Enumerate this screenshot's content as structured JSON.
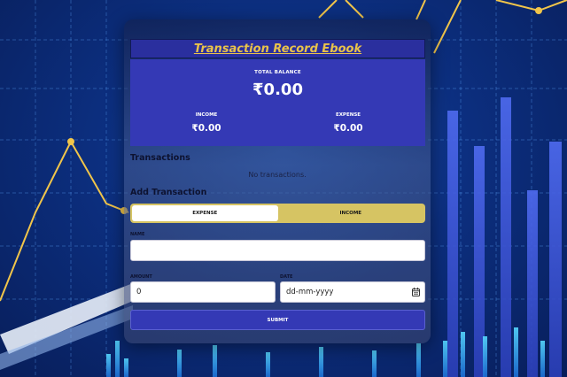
{
  "app": {
    "title": "Transaction Record Ebook"
  },
  "balance": {
    "total_label": "TOTAL BALANCE",
    "total_value": "₹0.00",
    "income_label": "INCOME",
    "income_value": "₹0.00",
    "expense_label": "EXPENSE",
    "expense_value": "₹0.00"
  },
  "transactions": {
    "heading": "Transactions",
    "empty_text": "No transactions."
  },
  "form": {
    "heading": "Add Transaction",
    "toggle": {
      "expense_label": "EXPENSE",
      "income_label": "INCOME",
      "selected": "EXPENSE"
    },
    "name_label": "NAME",
    "name_value": "",
    "amount_label": "AMOUNT",
    "amount_value": "0",
    "date_label": "DATE",
    "date_placeholder": "dd-mm-yyyy",
    "submit_label": "SUBMIT"
  },
  "colors": {
    "panel": "#3439b5",
    "title_text": "#e9c34a",
    "toggle_bg": "#d6c463",
    "background": "#0c2f80"
  },
  "icons": {
    "date": "calendar-icon"
  }
}
